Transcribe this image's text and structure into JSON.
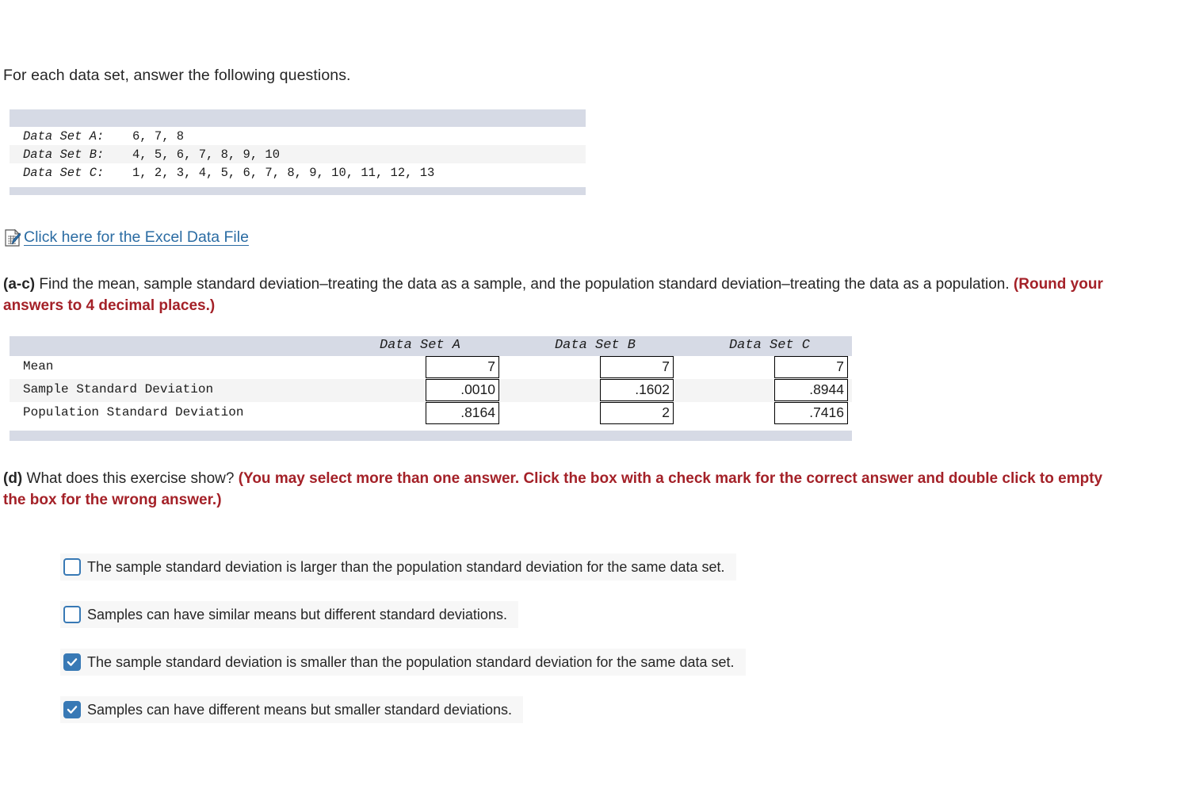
{
  "intro": "For each data set, answer the following questions.",
  "dataset_table": {
    "rows": [
      {
        "label": "Data Set A:",
        "values": "6, 7, 8"
      },
      {
        "label": "Data Set B:",
        "values": "4, 5, 6, 7, 8, 9, 10"
      },
      {
        "label": "Data Set C:",
        "values": "1, 2, 3, 4, 5, 6, 7, 8, 9, 10, 11, 12, 13"
      }
    ]
  },
  "excel_link": {
    "icon": "excel-document-icon",
    "label": "Click here for the Excel Data File"
  },
  "question_ac": {
    "tag": "(a-c)",
    "body": " Find the mean, sample standard deviation–treating the data as a sample, and the population standard deviation–treating the data as a population. ",
    "instruction": "(Round your answers to 4 decimal places.)"
  },
  "answers_table": {
    "columns": [
      "Data Set A",
      "Data Set B",
      "Data Set C"
    ],
    "rows": [
      {
        "label": "Mean",
        "values": [
          "7",
          "7",
          "7"
        ]
      },
      {
        "label": "Sample Standard Deviation",
        "values": [
          ".0010",
          ".1602",
          ".8944"
        ]
      },
      {
        "label": "Population Standard Deviation",
        "values": [
          ".8164",
          "2",
          ".7416"
        ]
      }
    ]
  },
  "question_d": {
    "tag": "(d)",
    "body": " What does this exercise show? ",
    "instruction": "(You may select more than one answer. Click the box with a check mark for the correct answer and double click to empty the box for the wrong answer.)"
  },
  "options": [
    {
      "checked": false,
      "label": "The sample standard deviation is larger than the population standard deviation for the same data set."
    },
    {
      "checked": false,
      "label": "Samples can have similar means but different standard deviations."
    },
    {
      "checked": true,
      "label": "The sample standard deviation is smaller than the population standard deviation for the same data set."
    },
    {
      "checked": true,
      "label": "Samples can have different means but smaller standard deviations."
    }
  ],
  "colors": {
    "band": "#d6dae5",
    "stripe": "#f4f4f4",
    "link": "#2b6ca3",
    "red": "#a42128",
    "checkbox": "#3879b5"
  }
}
